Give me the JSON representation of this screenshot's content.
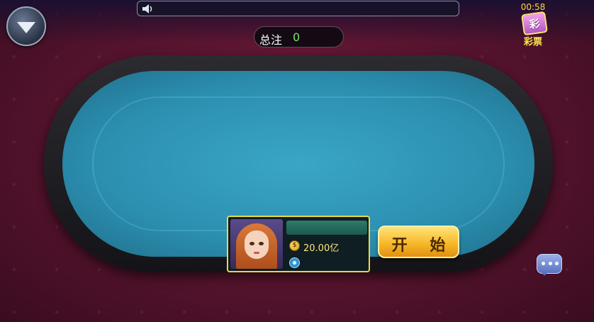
{
  "clock": "00:58",
  "lottery": {
    "icon_char": "彩",
    "label": "彩票"
  },
  "total_bet": {
    "label": "总注",
    "value": "0"
  },
  "player": {
    "name": "",
    "money": "20.00亿",
    "chips": ""
  },
  "start_button": "开 始",
  "colors": {
    "table_felt": "#2c8fb0",
    "background": "#5b1530",
    "accent": "#e8d84a",
    "button": "#f7b92a"
  }
}
